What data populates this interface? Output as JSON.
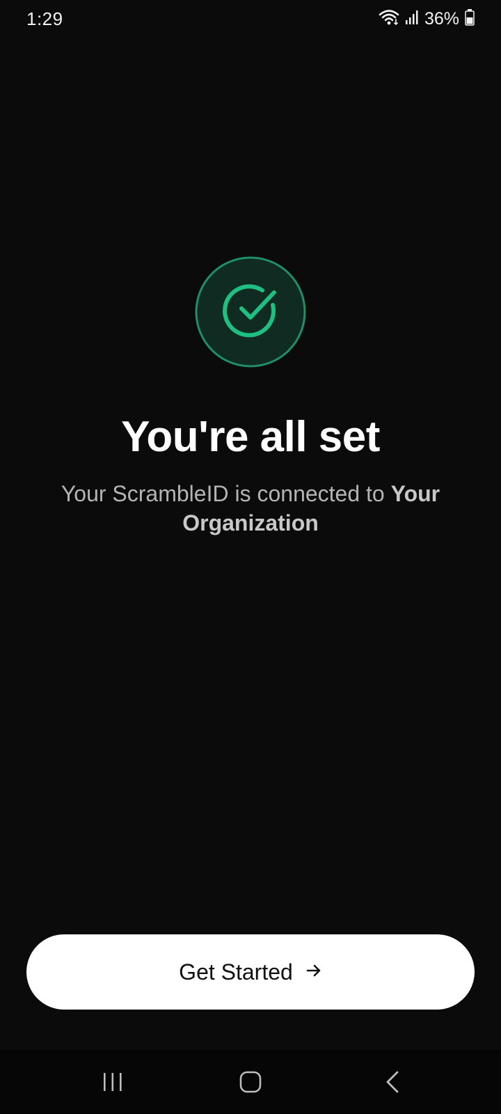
{
  "status_bar": {
    "time": "1:29",
    "battery_text": "36%",
    "icons": [
      "wifi-icon",
      "signal-icon",
      "battery-icon"
    ]
  },
  "success": {
    "icon": "check-circle-icon",
    "accent_color": "#1fbf83",
    "bg_color": "#0f2b22"
  },
  "content": {
    "title": "You're all set",
    "subtitle_prefix": "Your ScrambleID is connected to ",
    "organization": "Your Organization"
  },
  "cta": {
    "label": "Get Started",
    "icon": "arrow-right-icon"
  },
  "nav": {
    "items": [
      "recent-apps-icon",
      "home-icon",
      "back-icon"
    ]
  }
}
